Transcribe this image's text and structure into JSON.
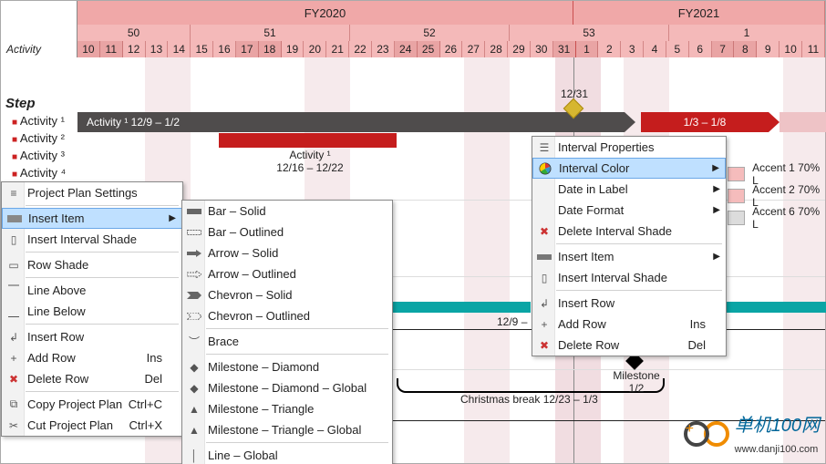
{
  "header": {
    "fy_left": "FY2020",
    "fy_right": "FY2021",
    "weeks": [
      "50",
      "51",
      "52",
      "53",
      "1"
    ],
    "days": [
      "10",
      "11",
      "12",
      "13",
      "14",
      "15",
      "16",
      "17",
      "18",
      "19",
      "20",
      "21",
      "22",
      "23",
      "24",
      "25",
      "26",
      "27",
      "28",
      "29",
      "30",
      "31",
      "1",
      "2",
      "3",
      "4",
      "5",
      "6",
      "7",
      "8",
      "9",
      "10",
      "11"
    ],
    "activity_label": "Activity"
  },
  "step_heading": "Step",
  "steps": [
    "Activity ¹",
    "Activity ²",
    "Activity ³",
    "Activity ⁴"
  ],
  "bars": {
    "a1": {
      "name": "Activity ¹ 12/9 – 1/2"
    },
    "a1_sub_top": "Activity ¹",
    "a1_sub_bot": "12/16 – 12/22",
    "a2": "1/3 – 1/8",
    "christmas": "Christmas break 12/23 – 1/3",
    "range_teal": "12/9 –",
    "milestone_gold": "12/31",
    "milestone_black_top": "Milestone",
    "milestone_black_bot": "1/2"
  },
  "menuA": {
    "settings": "Project Plan Settings",
    "insert_item": "Insert Item",
    "insert_shade": "Insert Interval Shade",
    "row_shade": "Row Shade",
    "line_above": "Line Above",
    "line_below": "Line Below",
    "insert_row": "Insert Row",
    "add_row": "Add Row",
    "add_row_sc": "Ins",
    "delete_row": "Delete Row",
    "delete_row_sc": "Del",
    "copy": "Copy Project Plan",
    "copy_sc": "Ctrl+C",
    "cut": "Cut Project Plan",
    "cut_sc": "Ctrl+X"
  },
  "menuB": {
    "bar_solid": "Bar – Solid",
    "bar_out": "Bar – Outlined",
    "arrow_solid": "Arrow – Solid",
    "arrow_out": "Arrow – Outlined",
    "chev_solid": "Chevron – Solid",
    "chev_out": "Chevron – Outlined",
    "brace": "Brace",
    "ms_d": "Milestone – Diamond",
    "ms_dg": "Milestone – Diamond – Global",
    "ms_t": "Milestone – Triangle",
    "ms_tg": "Milestone – Triangle – Global",
    "line_g": "Line – Global"
  },
  "menuC": {
    "props": "Interval Properties",
    "color": "Interval Color",
    "date_label": "Date in Label",
    "date_fmt": "Date Format",
    "del_shade": "Delete Interval Shade",
    "insert_item": "Insert Item",
    "insert_shade": "Insert Interval Shade",
    "insert_row": "Insert Row",
    "add_row": "Add Row",
    "add_row_sc": "Ins",
    "delete_row": "Delete Row",
    "delete_row_sc": "Del"
  },
  "swatches": {
    "a": "Accent 1 70% L",
    "b": "Accent 2 70% L",
    "c": "Accent 6 70% L"
  },
  "logo": {
    "cn": "单机100网",
    "url": "www.danji100.com"
  }
}
